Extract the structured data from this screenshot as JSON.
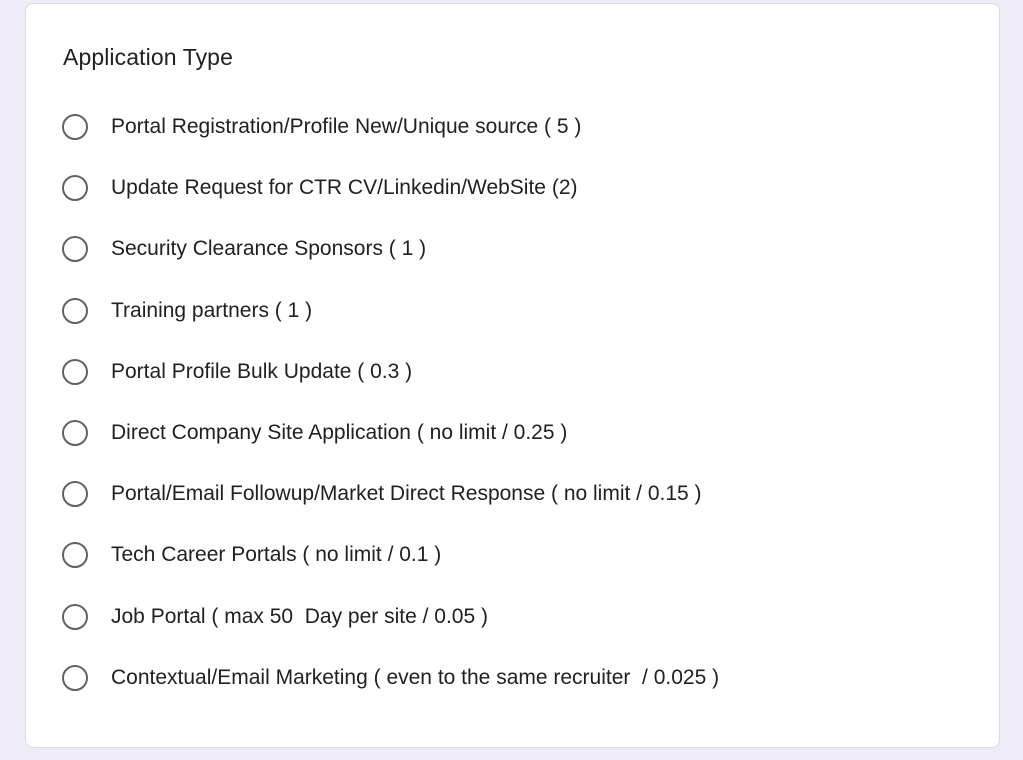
{
  "question": {
    "title": "Application Type",
    "options": [
      {
        "label": "Portal Registration/Profile New/Unique source ( 5 )",
        "selected": false
      },
      {
        "label": "Update Request for CTR CV/Linkedin/WebSite (2)",
        "selected": false
      },
      {
        "label": "Security Clearance Sponsors ( 1 )",
        "selected": false
      },
      {
        "label": "Training partners ( 1 )",
        "selected": false
      },
      {
        "label": "Portal Profile Bulk Update ( 0.3 )",
        "selected": false
      },
      {
        "label": "Direct Company Site Application ( no limit / 0.25 )",
        "selected": false
      },
      {
        "label": "Portal/Email Followup/Market Direct Response ( no limit / 0.15 )",
        "selected": false
      },
      {
        "label": "Tech Career Portals ( no limit / 0.1 )",
        "selected": false
      },
      {
        "label": "Job Portal ( max 50  Day per site / 0.05 )",
        "selected": false
      },
      {
        "label": "Contextual/Email Marketing ( even to the same recruiter  / 0.025 )",
        "selected": false
      }
    ]
  },
  "colors": {
    "page_background": "#f0ebf8",
    "card_background": "#ffffff",
    "radio_border": "#5f6368",
    "text": "#202124"
  }
}
